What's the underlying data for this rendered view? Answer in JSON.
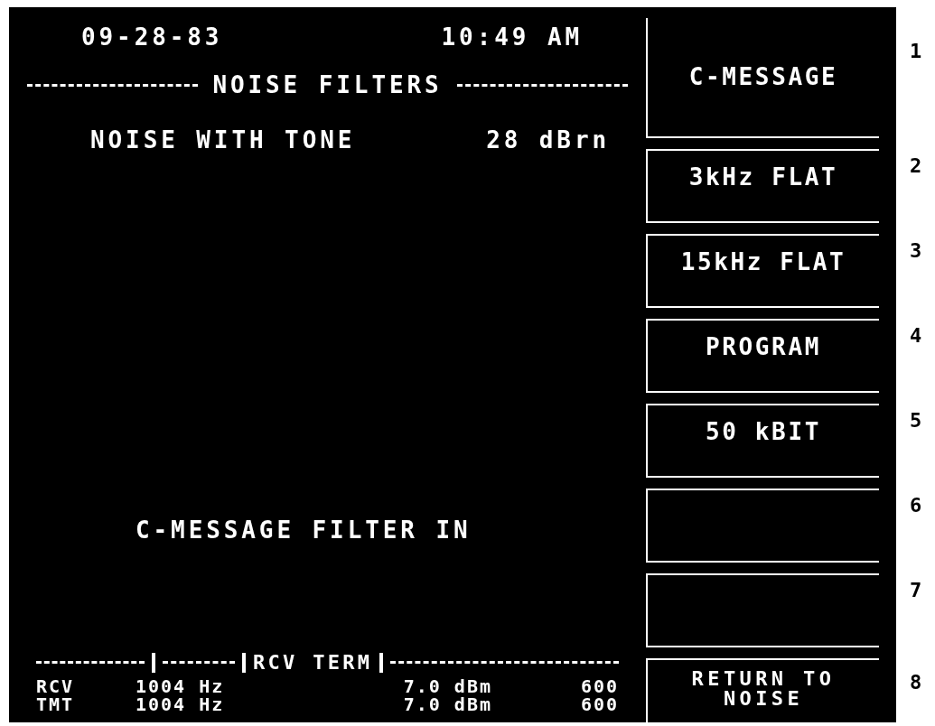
{
  "header": {
    "date": "09-28-83",
    "time": "10:49 AM"
  },
  "title": "NOISE FILTERS",
  "measurement": {
    "label": "NOISE WITH TONE",
    "value": "28 dBrn"
  },
  "status_message": "C-MESSAGE FILTER IN",
  "status_bar": {
    "label": "RCV TERM",
    "rows": [
      {
        "name": "RCV",
        "frequency": "1004 Hz",
        "power": "7.0 dBm",
        "impedance": "600"
      },
      {
        "name": "TMT",
        "frequency": "1004 Hz",
        "power": "7.0 dBm",
        "impedance": "600"
      }
    ]
  },
  "softkeys": [
    {
      "number": "1",
      "label": "C-MESSAGE"
    },
    {
      "number": "2",
      "label": "3kHz FLAT"
    },
    {
      "number": "3",
      "label": "15kHz FLAT"
    },
    {
      "number": "4",
      "label": "PROGRAM"
    },
    {
      "number": "5",
      "label": "50 kBIT"
    },
    {
      "number": "6"
    },
    {
      "number": "7"
    },
    {
      "number": "8",
      "label": "RETURN TO NOISE"
    }
  ]
}
